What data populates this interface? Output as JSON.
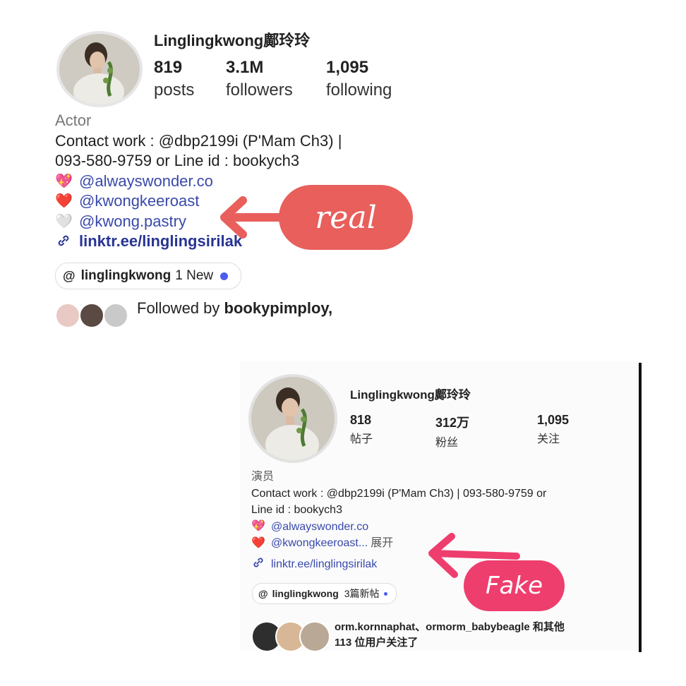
{
  "real": {
    "username": "Linglingkwong鄺玲玲",
    "stats": [
      {
        "num": "819",
        "label": "posts"
      },
      {
        "num": "3.1M",
        "label": "followers"
      },
      {
        "num": "1,095",
        "label": "following"
      }
    ],
    "role": "Actor",
    "contact_line1": "Contact work : @dbp2199i (P'Mam Ch3) |",
    "contact_line2": "093-580-9759 or Line id : bookych3",
    "links": [
      {
        "emoji": "💖",
        "handle": "@alwayswonder.co"
      },
      {
        "emoji": "❤️",
        "handle": "@kwongkeeroast"
      },
      {
        "emoji": "🤍",
        "handle": "@kwong.pastry"
      }
    ],
    "linktree": "linktr.ee/linglingsirilak",
    "threads": {
      "name": "linglingkwong",
      "badge": "1 New"
    },
    "followed_by_prefix": "Followed by ",
    "followed_by_user": "bookypimploy,",
    "badge_label": "real"
  },
  "fake": {
    "username": "Linglingkwong鄺玲玲",
    "stats": [
      {
        "num": "818",
        "label": "帖子"
      },
      {
        "num": "312万",
        "label": "粉丝"
      },
      {
        "num": "1,095",
        "label": "关注"
      }
    ],
    "role": "演员",
    "contact_line1": "Contact work : @dbp2199i (P'Mam Ch3) | 093-580-9759 or",
    "contact_line2": "Line id : bookych3",
    "links": [
      {
        "emoji": "💖",
        "handle": "@alwayswonder.co"
      },
      {
        "emoji": "❤️",
        "handle": "@kwongkeeroast...",
        "more": "展开"
      }
    ],
    "linktree": "linktr.ee/linglingsirilak",
    "threads": {
      "name": "linglingkwong",
      "badge": "3篇新帖"
    },
    "followed_line1": "orm.kornnaphat、ormorm_babybeagle 和其他",
    "followed_line2": "113 位用户关注了",
    "badge_label": "Fake"
  },
  "colors": {
    "real_badge": "#e85f5c",
    "fake_badge": "#ee3e6e",
    "link": "#3949ab",
    "new_dot": "#4c5df0"
  }
}
